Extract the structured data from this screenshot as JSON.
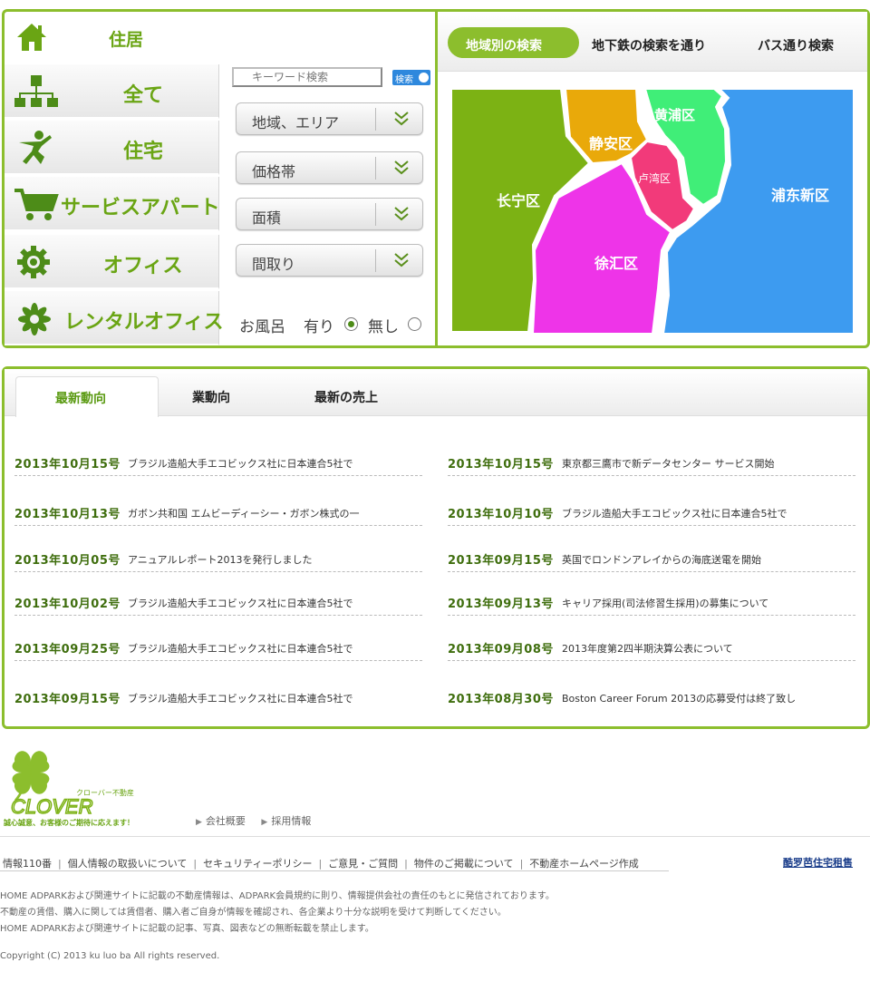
{
  "categories": {
    "header": "住居",
    "items": [
      {
        "label": "全て",
        "icon": "sitemap-icon"
      },
      {
        "label": "住宅",
        "icon": "person-icon"
      },
      {
        "label": "サービスアパート",
        "icon": "cart-icon"
      },
      {
        "label": "オフィス",
        "icon": "gear-icon"
      },
      {
        "label": "レンタルオフィス",
        "icon": "flower-icon"
      }
    ]
  },
  "filters": {
    "keyword_placeholder": "キーワード検索",
    "keyword_button": "検索",
    "dropdowns": [
      "地域、エリア",
      "価格帯",
      "面積",
      "間取り"
    ],
    "bath": {
      "label": "お風呂",
      "yes": "有り",
      "no": "無し",
      "selected": "有り"
    }
  },
  "map": {
    "tabs": [
      "地域別の検索",
      "地下鉄の検索を通り",
      "バス通り検索"
    ],
    "active_tab": "地域別の検索",
    "districts": [
      {
        "name": "长宁区",
        "color": "#7cb214"
      },
      {
        "name": "静安区",
        "color": "#e9a90a"
      },
      {
        "name": "黄浦区",
        "color": "#40ee78"
      },
      {
        "name": "卢湾区",
        "color": "#f23a7a"
      },
      {
        "name": "徐汇区",
        "color": "#ee34e8"
      },
      {
        "name": "浦东新区",
        "color": "#3d9bf0"
      }
    ]
  },
  "news": {
    "tabs": [
      "最新動向",
      "業動向",
      "最新の売上"
    ],
    "active_tab": "最新動向",
    "left": [
      {
        "date": "2013年10月15号",
        "text": "ブラジル造船大手エコビックス社に日本連合5社で"
      },
      {
        "date": "2013年10月13号",
        "text": "ガボン共和国 エムビーディーシー・ガボン株式の一"
      },
      {
        "date": "2013年10月05号",
        "text": "アニュアルレポート2013を発行しました"
      },
      {
        "date": "2013年10月02号",
        "text": "ブラジル造船大手エコビックス社に日本連合5社で"
      },
      {
        "date": "2013年09月25号",
        "text": "ブラジル造船大手エコビックス社に日本連合5社で"
      },
      {
        "date": "2013年09月15号",
        "text": "ブラジル造船大手エコビックス社に日本連合5社で"
      }
    ],
    "right": [
      {
        "date": "2013年10月15号",
        "text": "東京都三鷹市で新データセンター サービス開始"
      },
      {
        "date": "2013年10月10号",
        "text": "ブラジル造船大手エコビックス社に日本連合5社で"
      },
      {
        "date": "2013年09月15号",
        "text": "英国でロンドンアレイからの海底送電を開始"
      },
      {
        "date": "2013年09月13号",
        "text": "キャリア採用(司法修習生採用)の募集について"
      },
      {
        "date": "2013年09月08号",
        "text": "2013年度第2四半期決算公表について"
      },
      {
        "date": "2013年08月30号",
        "text": "Boston Career Forum 2013の応募受付は終了致し"
      }
    ]
  },
  "footer": {
    "logo_text": "CLOVER",
    "logo_sub": "クローバー不動産",
    "logo_tagline": "誠心誠意、お客様のご期待に応えます！",
    "company_links": [
      "会社概要",
      "採用情報"
    ],
    "nav": [
      "情報110番",
      "個人情報の取扱いについて",
      "セキュリティーポリシー",
      "ご意見・ご質問",
      "物件のご掲載について",
      "不動産ホームページ作成"
    ],
    "right_link": "酷罗芭住宅租售",
    "disclaimers": [
      "HOME ADPARKおよび関連サイトに記載の不動産情報は、ADPARK会員規約に則り、情報提供会社の責任のもとに発信されております。",
      "不動産の賃借、購入に関しては賃借者、購入者ご自身が情報を確認され、各企業より十分な説明を受けて判断してください。",
      "HOME ADPARKおよび関連サイトに記載の記事、写真、図表などの無断転載を禁止します。"
    ],
    "copyright": "Copyright (C) 2013 ku luo ba All rights reserved."
  }
}
